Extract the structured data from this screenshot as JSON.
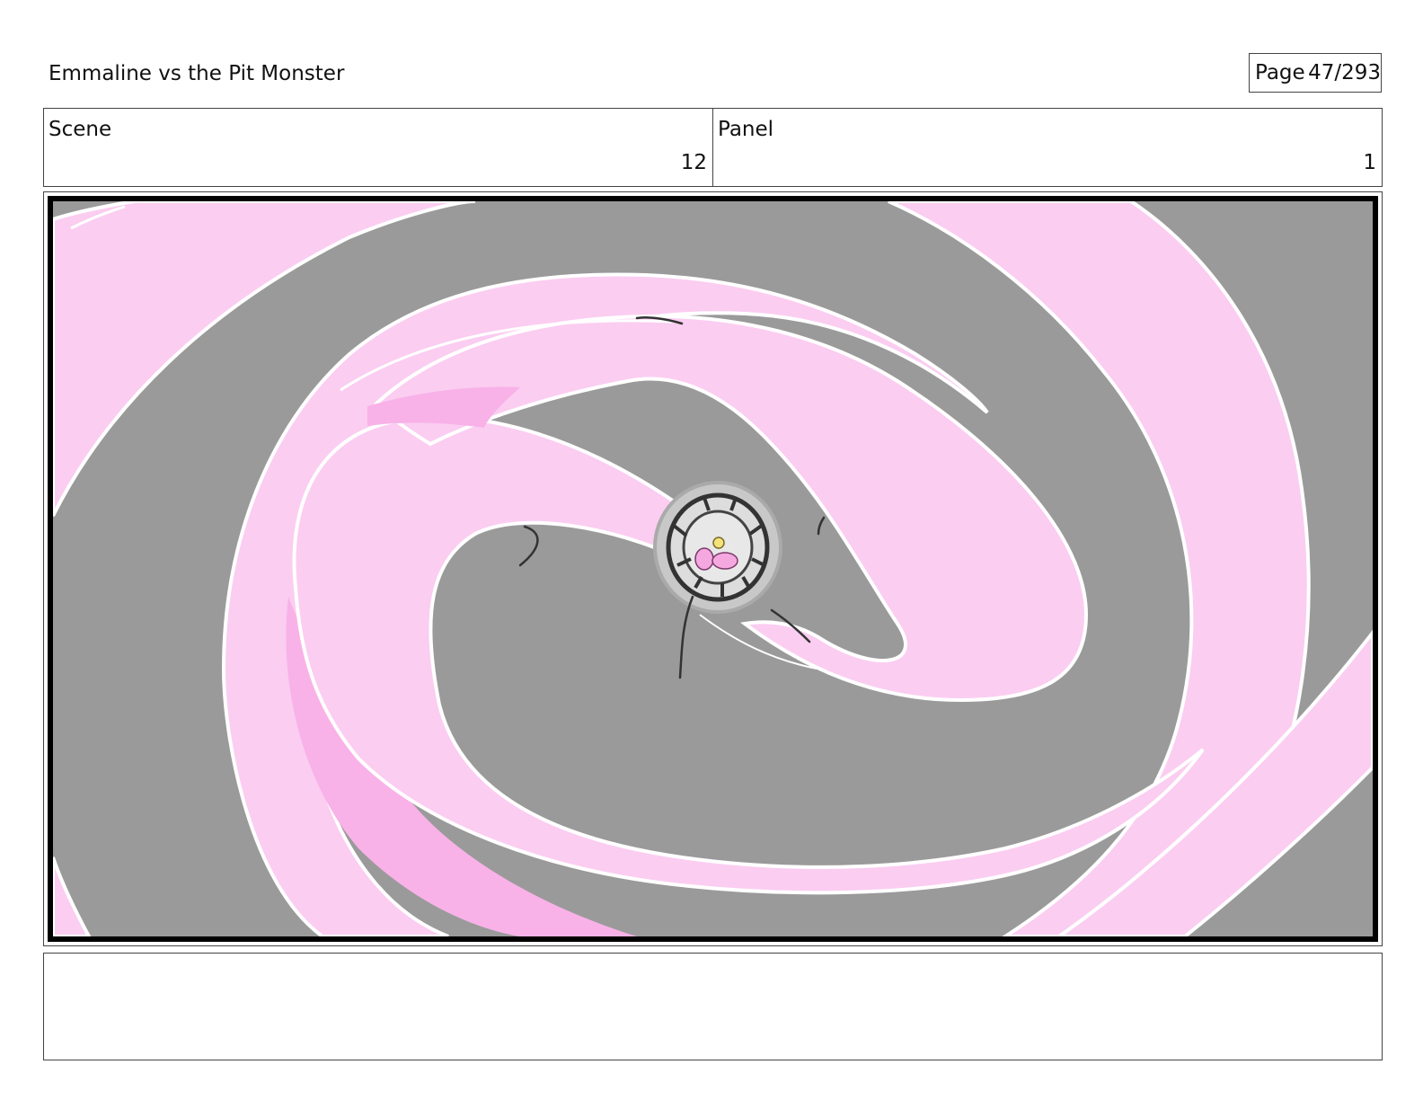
{
  "document": {
    "title": "Emmaline vs the Pit Monster",
    "page_label": "Page",
    "page_number": "47/293"
  },
  "info": {
    "scene_label": "Scene",
    "scene_value": "12",
    "panel_label": "Panel",
    "panel_value": "1"
  },
  "panel_art": {
    "background_color": "#9a9a9a",
    "swirl_color": "#fbcdf1",
    "swirl_shadow_color": "#f8b2e8",
    "outline_color": "#ffffff",
    "center_tunnel_color": "#c8c8c8",
    "sketch_line_color": "#333333"
  },
  "notes": {
    "text": ""
  }
}
